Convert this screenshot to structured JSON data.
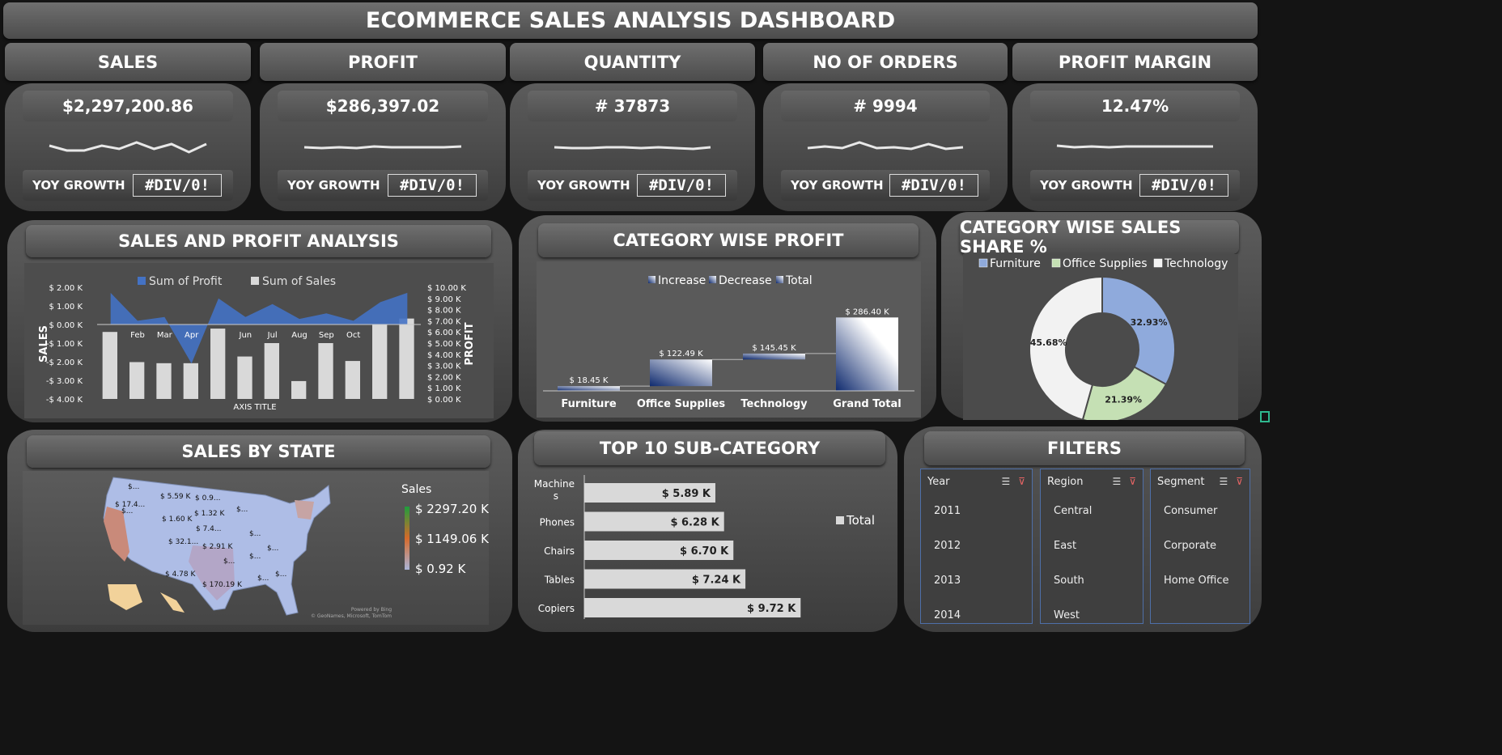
{
  "title": "ECOMMERCE SALES ANALYSIS DASHBOARD",
  "kpis": [
    {
      "label": "SALES",
      "value": "$2,297,200.86",
      "yoy_label": "YOY GROWTH",
      "yoy_value": "#DIV/0!"
    },
    {
      "label": "PROFIT",
      "value": "$286,397.02",
      "yoy_label": "YOY GROWTH",
      "yoy_value": "#DIV/0!"
    },
    {
      "label": "QUANTITY",
      "value": "# 37873",
      "yoy_label": "YOY GROWTH",
      "yoy_value": "#DIV/0!"
    },
    {
      "label": "NO OF ORDERS",
      "value": "# 9994",
      "yoy_label": "YOY GROWTH",
      "yoy_value": "#DIV/0!"
    },
    {
      "label": "PROFIT MARGIN",
      "value": "12.47%",
      "yoy_label": "YOY GROWTH",
      "yoy_value": "#DIV/0!"
    }
  ],
  "sections": {
    "sales_profit": "SALES AND PROFIT ANALYSIS",
    "category_profit": "CATEGORY WISE PROFIT",
    "category_share": "CATEGORY WISE SALES SHARE %",
    "sales_state": "SALES BY STATE",
    "top10": "TOP 10 SUB-CATEGORY",
    "filters": "FILTERS"
  },
  "chart_data": [
    {
      "type": "bar",
      "title": "",
      "series": [
        {
          "name": "Sum of Profit",
          "type": "area",
          "values": [
            1.7,
            0.2,
            0.4,
            -2.1,
            1.4,
            0.4,
            1.1,
            0.3,
            0.6,
            0.2,
            1.2,
            1.7
          ]
        },
        {
          "name": "Sum of Sales",
          "type": "bar",
          "values": [
            6.0,
            3.3,
            3.2,
            3.2,
            6.3,
            3.8,
            5.0,
            1.6,
            5.0,
            3.4,
            6.7,
            7.2
          ]
        }
      ],
      "categories": [
        "",
        "Feb",
        "Mar",
        "Apr",
        "",
        "Jun",
        "Jul",
        "Aug",
        "Sep",
        "Oct",
        "",
        ""
      ],
      "ylabel": "SALES",
      "y2label": "PROFIT",
      "xlabel": "AXIS TITLE",
      "y_ticks": [
        "$ 2.00 K",
        "$ 1.00 K",
        "$ 0.00 K",
        "-$ 1.00 K",
        "-$ 2.00 K",
        "-$ 3.00 K",
        "-$ 4.00 K"
      ],
      "y2_ticks": [
        "$ 10.00 K",
        "$ 9.00 K",
        "$ 8.00 K",
        "$ 7.00 K",
        "$ 6.00 K",
        "$ 5.00 K",
        "$ 4.00 K",
        "$ 3.00 K",
        "$ 2.00 K",
        "$ 1.00 K",
        "$ 0.00 K"
      ],
      "ylim": [
        -4,
        2
      ],
      "y2lim": [
        0,
        10
      ]
    },
    {
      "type": "bar",
      "subtype": "waterfall",
      "legend": [
        "Increase",
        "Decrease",
        "Total"
      ],
      "categories": [
        "Furniture",
        "Office Supplies",
        "Technology",
        "Grand Total"
      ],
      "values": [
        18.45,
        104.04,
        23.0,
        286.4
      ],
      "labels": [
        "$ 18.45 K",
        "$ 122.49 K",
        "$ 145.45 K",
        "$ 286.40 K"
      ],
      "ylim": [
        0,
        300
      ]
    },
    {
      "type": "pie",
      "subtype": "donut",
      "categories": [
        "Furniture",
        "Office Supplies",
        "Technology"
      ],
      "values": [
        32.93,
        21.39,
        45.68
      ],
      "labels": [
        "32.93%",
        "21.39%",
        "45.68%"
      ],
      "colors": [
        "#8faadc",
        "#c5e0b4",
        "#f2f2f2"
      ],
      "legend": "top"
    },
    {
      "type": "bar",
      "orientation": "horizontal",
      "categories": [
        "Machine s",
        "Phones",
        "Chairs",
        "Tables",
        "Copiers"
      ],
      "values": [
        5.89,
        6.28,
        6.7,
        7.24,
        9.72
      ],
      "labels": [
        "$ 5.89 K",
        "$ 6.28 K",
        "$ 6.70 K",
        "$ 7.24 K",
        "$ 9.72 K"
      ],
      "legend_label": "Total"
    }
  ],
  "map": {
    "legend_title": "Sales",
    "legend_values": [
      "$ 2297.20 K",
      "$ 1149.06 K",
      "$ 0.92 K"
    ],
    "labels": [
      "$...",
      "$ 17.4...",
      "$ 5.59 K",
      "$ 0.9...",
      "$...",
      "$ 1.60 K",
      "$ 1.32 K",
      "$...",
      "$ 7.4...",
      "$ 32.1...",
      "$ 2.91 K",
      "$...",
      "$ 4.78 K",
      "$ 170.19 K",
      "$...",
      "$...",
      "$...",
      "$...",
      "$..."
    ],
    "credit1": "Powered by Bing",
    "credit2": "© GeoNames, Microsoft, TomTom"
  },
  "filters": [
    {
      "title": "Year",
      "items": [
        "2011",
        "2012",
        "2013",
        "2014"
      ]
    },
    {
      "title": "Region",
      "items": [
        "Central",
        "East",
        "South",
        "West"
      ]
    },
    {
      "title": "Segment",
      "items": [
        "Consumer",
        "Corporate",
        "Home Office"
      ]
    }
  ]
}
